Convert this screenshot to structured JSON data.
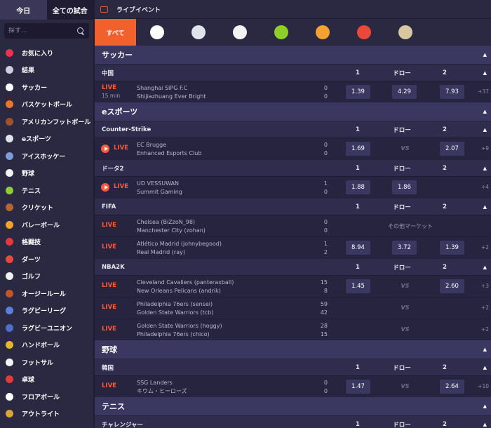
{
  "sidebar": {
    "tabs": [
      {
        "label": "今日"
      },
      {
        "label": "全ての試合"
      }
    ],
    "search_placeholder": "探す...",
    "sports": [
      {
        "label": "お気に入り",
        "icon": "heart-icon",
        "color": "#e8344e"
      },
      {
        "label": "結果",
        "icon": "results-icon",
        "color": "#cfcde0"
      },
      {
        "label": "サッカー",
        "icon": "soccer-ball-icon",
        "color": "#ffffff"
      },
      {
        "label": "バスケットボール",
        "icon": "basketball-icon",
        "color": "#e8772a"
      },
      {
        "label": "アメリカンフットボール",
        "icon": "american-football-icon",
        "color": "#a0522d"
      },
      {
        "label": "eスポーツ",
        "icon": "mouse-icon",
        "color": "#dfe3ea"
      },
      {
        "label": "アイスホッケー",
        "icon": "hockey-sticks-icon",
        "color": "#7e9bd8"
      },
      {
        "label": "野球",
        "icon": "baseball-icon",
        "color": "#f2f2f2"
      },
      {
        "label": "テニス",
        "icon": "tennis-ball-icon",
        "color": "#8fcf2a"
      },
      {
        "label": "クリケット",
        "icon": "cricket-bat-icon",
        "color": "#b5652f"
      },
      {
        "label": "バレーボール",
        "icon": "volleyball-icon",
        "color": "#f3a12f"
      },
      {
        "label": "格闘技",
        "icon": "boxing-glove-icon",
        "color": "#e23a3a"
      },
      {
        "label": "ダーツ",
        "icon": "dartboard-icon",
        "color": "#e8493a"
      },
      {
        "label": "ゴルフ",
        "icon": "golf-icon",
        "color": "#f0f0f0"
      },
      {
        "label": "オージールール",
        "icon": "aussie-rules-ball-icon",
        "color": "#c0572a"
      },
      {
        "label": "ラグビーリーグ",
        "icon": "rugby-ball-icon",
        "color": "#5a7fd6"
      },
      {
        "label": "ラグビーユニオン",
        "icon": "rugby-union-icon",
        "color": "#4e6fc8"
      },
      {
        "label": "ハンドボール",
        "icon": "handball-icon",
        "color": "#e6b62c"
      },
      {
        "label": "フットサル",
        "icon": "futsal-icon",
        "color": "#f4f4f4"
      },
      {
        "label": "卓球",
        "icon": "table-tennis-icon",
        "color": "#e23a3a"
      },
      {
        "label": "フロアボール",
        "icon": "floorball-icon",
        "color": "#ffffff"
      },
      {
        "label": "アウトライト",
        "icon": "trophy-icon",
        "color": "#d9a53a"
      }
    ]
  },
  "header": {
    "title": "ライブイベント",
    "icon": "tv-icon"
  },
  "filters": {
    "all_label": "すべて",
    "icons": [
      {
        "name": "soccer-ball-icon",
        "color": "#ffffff"
      },
      {
        "name": "mouse-icon",
        "color": "#dfe3ea"
      },
      {
        "name": "baseball-icon",
        "color": "#f2f2f2"
      },
      {
        "name": "tennis-ball-icon",
        "color": "#8fcf2a"
      },
      {
        "name": "volleyball-icon",
        "color": "#f3a12f"
      },
      {
        "name": "dartboard-icon",
        "color": "#e8493a"
      },
      {
        "name": "billiards-rack-icon",
        "color": "#d8c7a0"
      }
    ]
  },
  "cols": {
    "one": "1",
    "draw": "ドロー",
    "two": "2"
  },
  "live_label": "LIVE",
  "vs_label": "VS",
  "other_markets": "その他マーケット",
  "categories": [
    {
      "title": "サッカー",
      "leagues": [
        {
          "name": "中国",
          "events": [
            {
              "play": false,
              "minute": "15 min",
              "home": "Shanghai SIPG F.C",
              "away": "Shijiazhuang Ever Bright",
              "hs": "0",
              "as": "0",
              "o1": "1.39",
              "od": "4.29",
              "o2": "7.93",
              "more": "+37"
            }
          ]
        }
      ]
    },
    {
      "title": "eスポーツ",
      "leagues": [
        {
          "name": "Counter-Strike",
          "events": [
            {
              "play": true,
              "home": "EC Brugge",
              "away": "Enhanced Esports Club",
              "hs": "0",
              "as": "0",
              "o1": "1.69",
              "vs": true,
              "o2": "2.07",
              "more": "+9"
            }
          ]
        },
        {
          "name": "ドータ2",
          "events": [
            {
              "play": true,
              "home": "UD VESSUWAN",
              "away": "Summit Gaming",
              "hs": "1",
              "as": "0",
              "o1": "1.88",
              "od": "1.86",
              "more": "+4"
            }
          ]
        },
        {
          "name": "FIFA",
          "events": [
            {
              "play": false,
              "home": "Chelsea (BiZzoN_98)",
              "away": "Manchester City (zohan)",
              "hs": "0",
              "as": "0",
              "other": true
            },
            {
              "play": false,
              "home": "Atlético Madrid (johnybegood)",
              "away": "Real Madrid (ray)",
              "hs": "1",
              "as": "2",
              "o1": "8.94",
              "od": "3.72",
              "o2": "1.39",
              "more": "+2"
            }
          ]
        },
        {
          "name": "NBA2K",
          "events": [
            {
              "play": false,
              "home": "Cleveland Cavaliers (panteraxball)",
              "away": "New Orleans Pelicans (andrik)",
              "hs": "15",
              "as": "8",
              "o1": "1.45",
              "vs": true,
              "o2": "2.60",
              "more": "+3"
            },
            {
              "play": false,
              "home": "Philadelphia 76ers (sensei)",
              "away": "Golden State Warriors (tcb)",
              "hs": "59",
              "as": "42",
              "vs": true,
              "more": "+2"
            },
            {
              "play": false,
              "home": "Golden State Warriors (hoggy)",
              "away": "Philadelphia 76ers (chico)",
              "hs": "28",
              "as": "15",
              "vs": true,
              "more": "+2"
            }
          ]
        }
      ]
    },
    {
      "title": "野球",
      "leagues": [
        {
          "name": "韓国",
          "events": [
            {
              "play": false,
              "home": "SSG Landers",
              "away": "キウム・ヒーローズ",
              "hs": "0",
              "as": "0",
              "o1": "1.47",
              "vs": true,
              "o2": "2.64",
              "more": "+10"
            }
          ]
        }
      ]
    },
    {
      "title": "テニス",
      "leagues": [
        {
          "name": "チャレンジャー",
          "events": []
        }
      ]
    }
  ]
}
